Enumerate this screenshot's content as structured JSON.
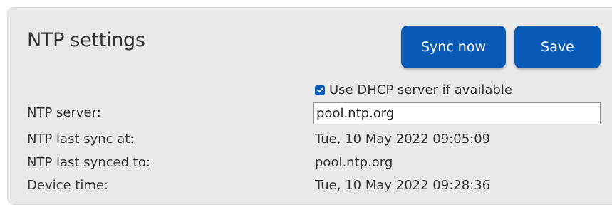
{
  "panel": {
    "title": "NTP settings"
  },
  "buttons": {
    "sync_label": "Sync now",
    "save_label": "Save"
  },
  "dhcp": {
    "label": "Use DHCP server if available",
    "checked": true
  },
  "fields": {
    "ntp_server_label": "NTP server:",
    "ntp_server_value": "pool.ntp.org",
    "last_sync_label": "NTP last sync at:",
    "last_sync_value": "Tue, 10 May 2022 09:05:09",
    "last_synced_to_label": "NTP last synced to:",
    "last_synced_to_value": "pool.ntp.org",
    "device_time_label": "Device time:",
    "device_time_value": "Tue, 10 May 2022 09:28:36"
  },
  "colors": {
    "accent": "#0a5bb8",
    "panel_bg": "#e9e9e9",
    "text": "#333333"
  },
  "icons": {
    "checkbox": "checkmark-icon"
  }
}
